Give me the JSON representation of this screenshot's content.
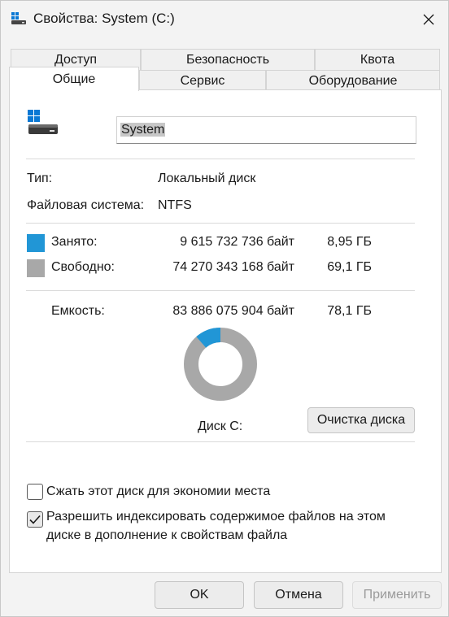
{
  "window": {
    "title": "Свойства: System (C:)"
  },
  "tabs": {
    "row1": [
      "Доступ",
      "Безопасность",
      "Квота"
    ],
    "row2": [
      "Общие",
      "Сервис",
      "Оборудование"
    ]
  },
  "general": {
    "drive_name": "System",
    "type_label": "Тип:",
    "type_value": "Локальный диск",
    "fs_label": "Файловая система:",
    "fs_value": "NTFS",
    "used_label": "Занято:",
    "used_bytes": "9 615 732 736 байт",
    "used_size": "8,95 ГБ",
    "free_label": "Свободно:",
    "free_bytes": "74 270 343 168 байт",
    "free_size": "69,1 ГБ",
    "capacity_label": "Емкость:",
    "capacity_bytes": "83 886 075 904 байт",
    "capacity_size": "78,1 ГБ",
    "disk_label": "Диск C:",
    "cleanup_button": "Очистка диска",
    "compress_label": "Сжать этот диск для экономии места",
    "compress_checked": false,
    "index_label_line1": "Разрешить индексировать содержимое файлов на этом",
    "index_label_line2": "диске в дополнение к свойствам файла",
    "index_checked": true,
    "used_fraction": 0.1146
  },
  "colors": {
    "used": "#2196d6",
    "free": "#a8a8a8"
  },
  "icons": {
    "title": "drive-windows-icon",
    "drive": "drive-windows-icon",
    "close": "close-icon",
    "check": "checkmark-icon"
  },
  "footer": {
    "ok": "OK",
    "cancel": "Отмена",
    "apply": "Применить"
  }
}
